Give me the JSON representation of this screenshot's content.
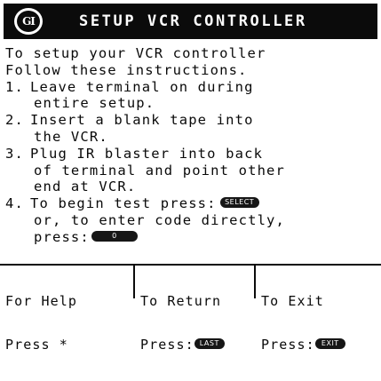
{
  "header": {
    "logo_text": "GI",
    "title": "SETUP VCR CONTROLLER"
  },
  "body": {
    "intro": [
      "To setup your VCR controller",
      "Follow these instructions."
    ],
    "steps": [
      {
        "number": "1.",
        "lines": [
          "Leave terminal on during",
          "entire setup."
        ]
      },
      {
        "number": "2.",
        "lines": [
          "Insert a blank tape into",
          "the VCR."
        ]
      },
      {
        "number": "3.",
        "lines": [
          "Plug IR blaster into back",
          "of terminal and point other",
          "end at VCR."
        ]
      },
      {
        "number": "4.",
        "line1": "To begin test press:",
        "line2": "or, to enter code directly,",
        "line3": "press:"
      }
    ],
    "keys": {
      "select": "SELECT",
      "zero": "0"
    }
  },
  "footer": {
    "help": {
      "line1": "For Help",
      "line2": "Press *"
    },
    "return": {
      "line1": "To Return",
      "line2": "Press:",
      "key": "LAST"
    },
    "exit": {
      "line1": "To Exit",
      "line2": "Press:",
      "key": "EXIT"
    }
  },
  "colors": {
    "background": "#ffffff",
    "foreground": "#0a0a0a",
    "header_bg": "#0b0b0b",
    "header_text": "#ffffff"
  }
}
